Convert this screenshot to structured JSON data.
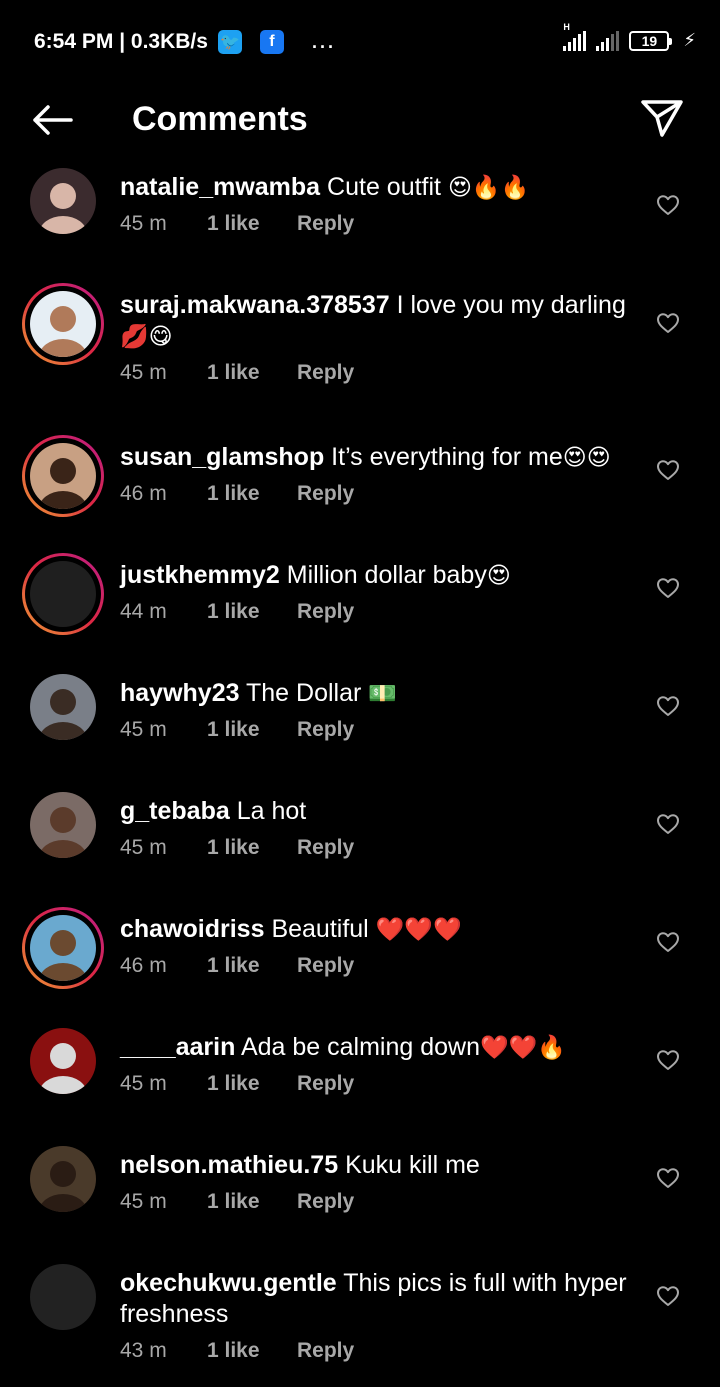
{
  "status_bar": {
    "time": "6:54 PM | 0.3KB/s",
    "battery": "19",
    "app_icons": [
      "twitter-icon",
      "facebook-icon"
    ],
    "overflow": "..."
  },
  "header": {
    "title": "Comments"
  },
  "comments": [
    {
      "user": "natalie_mwamba",
      "text": " Cute outfit ",
      "emoji": "😍🔥🔥",
      "time": "45 m",
      "likes": "1 like",
      "reply": "Reply"
    },
    {
      "user": "suraj.makwana.378537",
      "text": " I love you my darling ",
      "emoji": "💋😋",
      "time": "45 m",
      "likes": "1 like",
      "reply": "Reply"
    },
    {
      "user": "susan_glamshop",
      "text": " It’s everything for me",
      "emoji": "😍😍",
      "time": "46 m",
      "likes": "1 like",
      "reply": "Reply"
    },
    {
      "user": "justkhemmy2",
      "text": " Million dollar baby",
      "emoji": "😍",
      "time": "44 m",
      "likes": "1 like",
      "reply": "Reply"
    },
    {
      "user": "haywhy23",
      "text": " The Dollar ",
      "emoji": "💵",
      "time": "45 m",
      "likes": "1 like",
      "reply": "Reply"
    },
    {
      "user": "g_tebaba",
      "text": " La hot",
      "emoji": "",
      "time": "45 m",
      "likes": "1 like",
      "reply": "Reply"
    },
    {
      "user": "chawoidriss",
      "text": " Beautiful ",
      "emoji": "❤️❤️❤️",
      "time": "46 m",
      "likes": "1 like",
      "reply": "Reply"
    },
    {
      "user": "____aarin",
      "text": " Ada be calming down",
      "emoji": "❤️❤️🔥",
      "time": "45 m",
      "likes": "1 like",
      "reply": "Reply"
    },
    {
      "user": "nelson.mathieu.75",
      "text": " Kuku kill me",
      "emoji": "",
      "time": "45 m",
      "likes": "1 like",
      "reply": "Reply"
    },
    {
      "user": "okechukwu.gentle",
      "text": " This pics is full with hyper freshness",
      "emoji": "",
      "time": "43 m",
      "likes": "1 like",
      "reply": "Reply"
    }
  ],
  "colors": {
    "background": "#000000",
    "meta_text": "#a8a8a8",
    "story_ring": [
      "#f09433",
      "#dc2743",
      "#bc1888"
    ]
  }
}
